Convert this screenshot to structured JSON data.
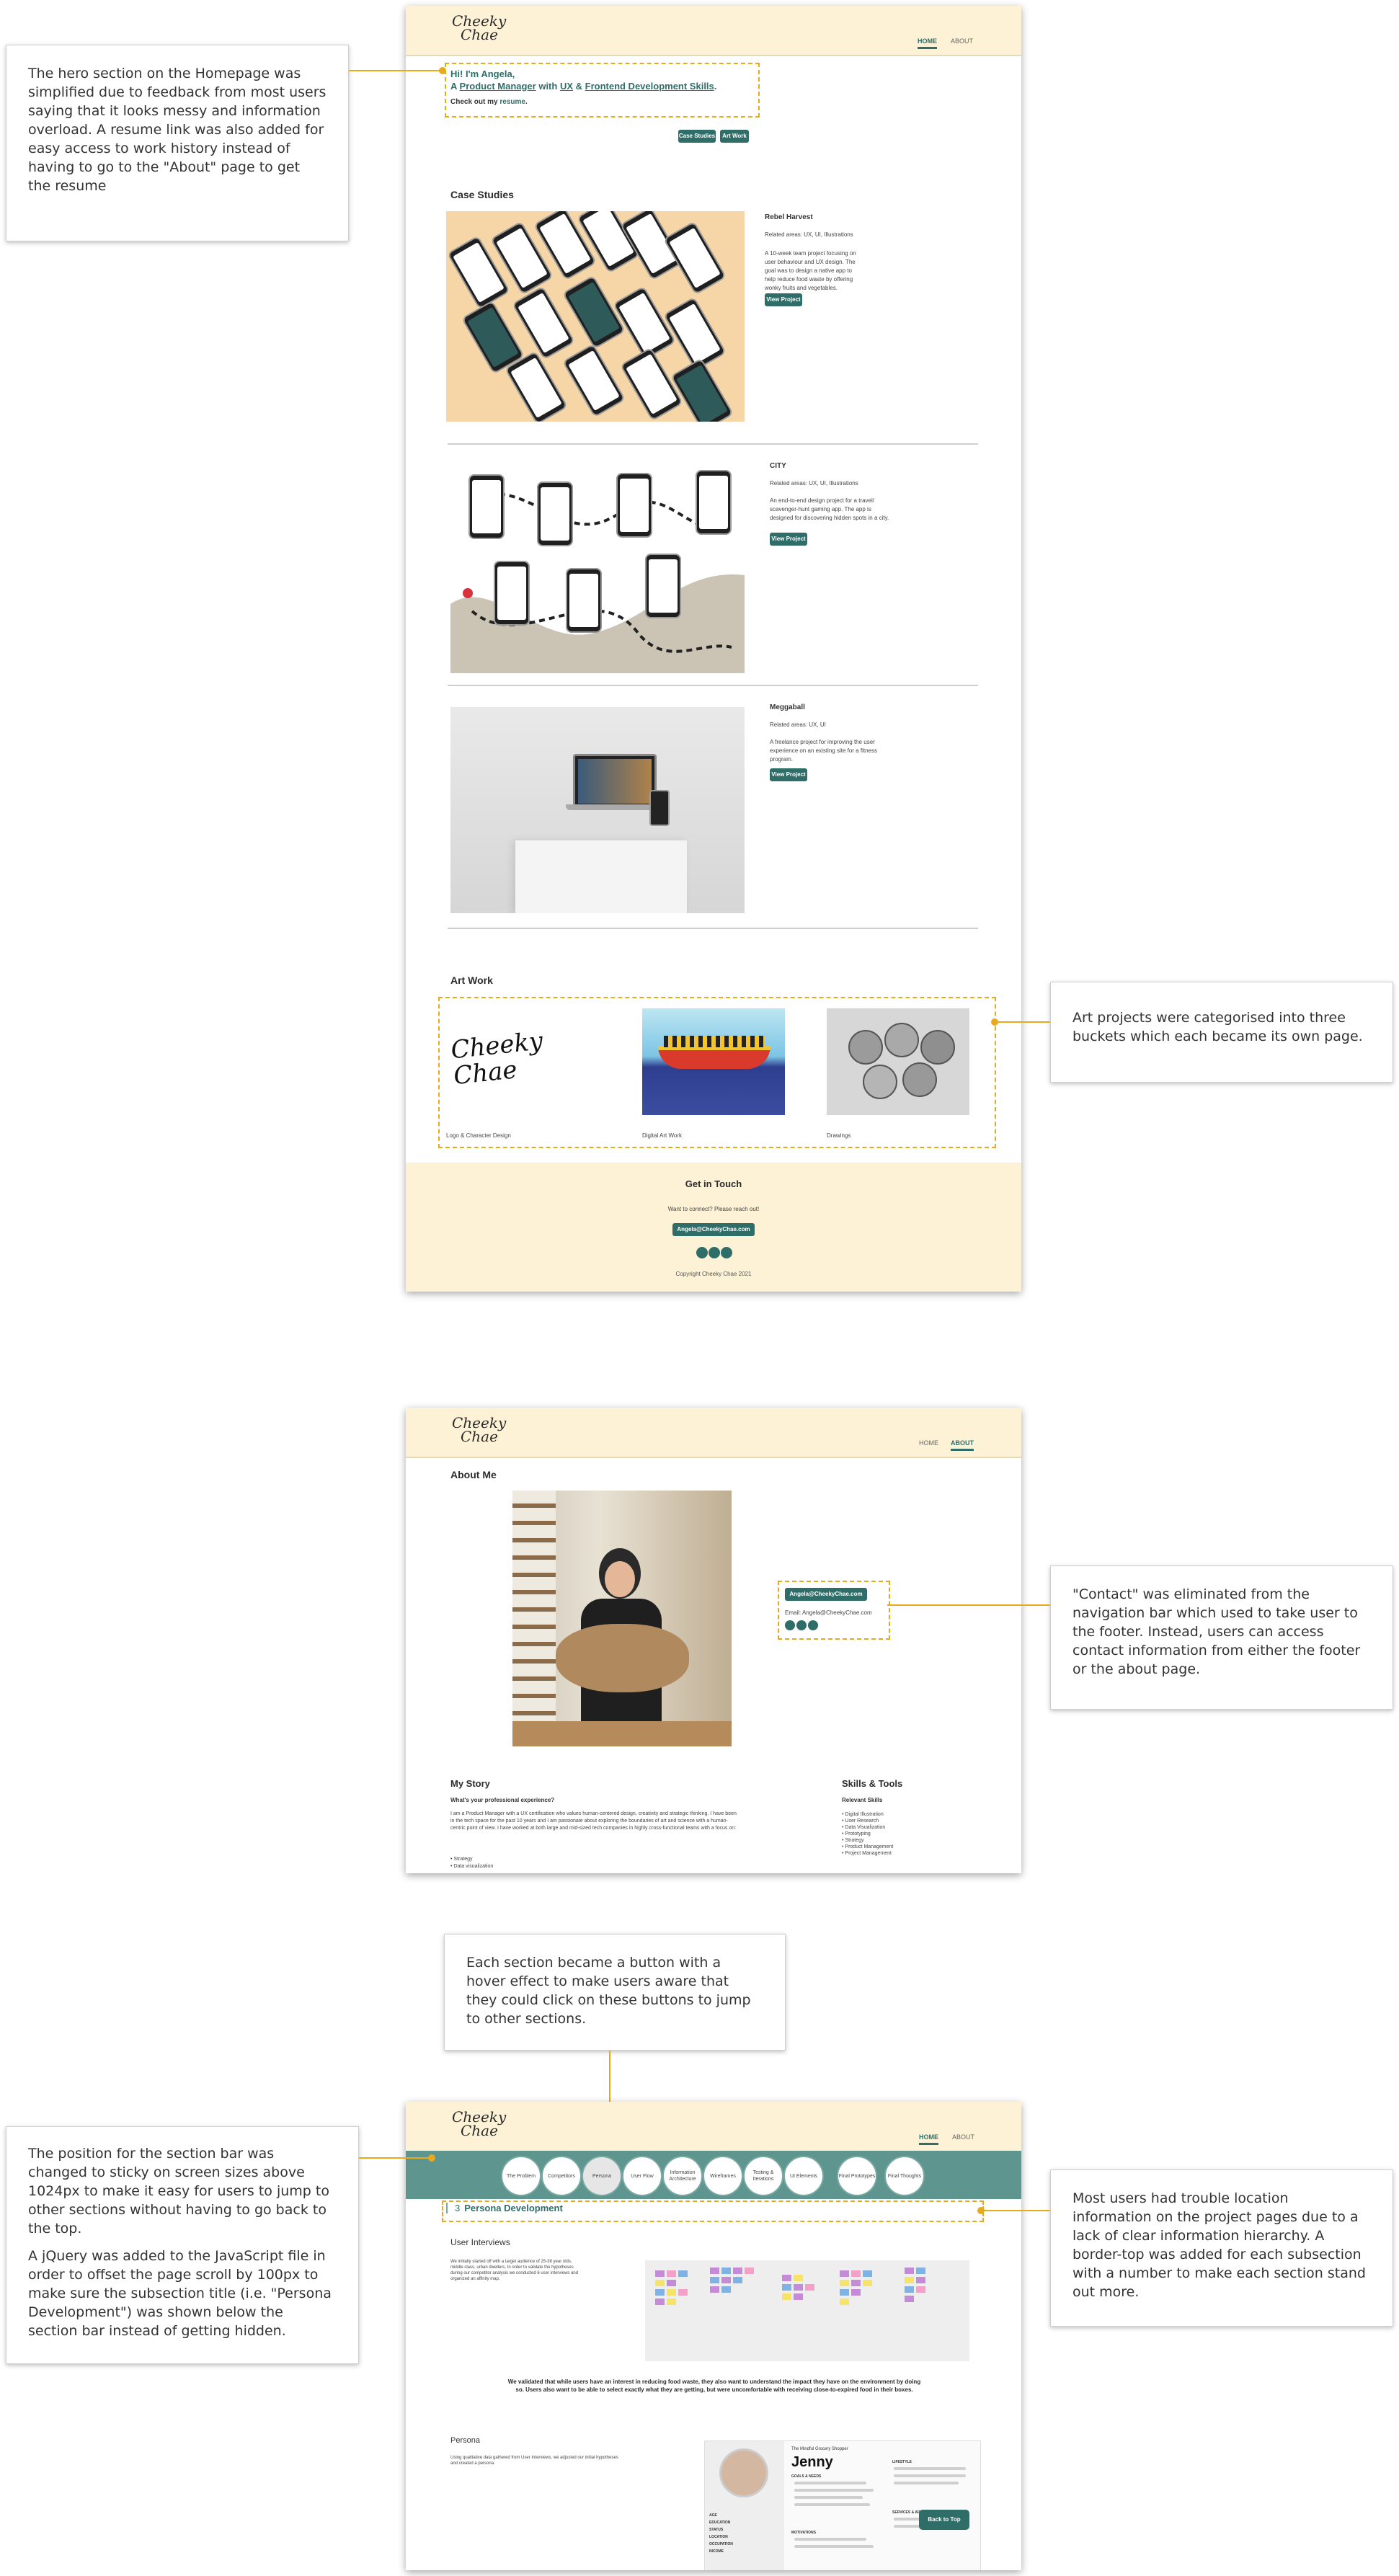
{
  "brand": {
    "logo_line1": "Cheeky",
    "logo_line2": "Chae"
  },
  "nav": {
    "home": "HOME",
    "about": "ABOUT"
  },
  "home": {
    "hero_line1": "Hi! I'm Angela,",
    "hero_a": "A ",
    "hero_pm": "Product Manager",
    "hero_with": " with ",
    "hero_ux": "UX",
    "hero_amp": " & ",
    "hero_fe": "Frontend Development Skills",
    "hero_dot": ".",
    "resume_prefix": "Check out my ",
    "resume_link": "resume",
    "resume_suffix": ".",
    "btn_case": "Case Studies",
    "btn_art": "Art Work",
    "case_title": "Case Studies",
    "cases": [
      {
        "title": "Rebel Harvest",
        "areas": "Related areas: UX, UI, Illustrations",
        "desc": "A 10-week team project focusing on user behaviour and UX design. The goal was to design a native app to help reduce food waste by offering wonky fruits and vegetables.",
        "btn": "View Project"
      },
      {
        "title": "CITY",
        "areas": "Related areas: UX, UI, Illustrations",
        "desc": "An end-to-end design project for a travel/ scavenger-hunt gaming app. The app is designed for discovering hidden spots in a city.",
        "btn": "View Project"
      },
      {
        "title": "Meggaball",
        "areas": "Related areas: UX, UI",
        "desc": "A freelance project for improving the user experience on an existing site for a fitness program.",
        "btn": "View Project"
      }
    ],
    "art_title": "Art Work",
    "art_items": [
      "Logo & Character Design",
      "Digital Art Work",
      "Drawings"
    ],
    "art_logo_text": "Cheeky Chae",
    "footer_title": "Get in Touch",
    "footer_sub": "Want to connect? Please reach out!",
    "footer_email": "Angela@CheekyChae.com",
    "footer_copy": "Copyright Cheeky Chae 2021"
  },
  "about": {
    "title": "About Me",
    "email_btn": "Angela@CheekyChae.com",
    "email_text": "Email: Angela@CheekyChae.com",
    "story_title": "My Story",
    "story_sub": "What's your professional experience?",
    "story_body": "I am a Product Manager with a UX certification who values human-centered design, creativity and strategic thinking. I have been in the tech space for the past 10 years and I am passionate about exploring the boundaries of art and science with a human-centric point of view. I have worked at both large and mid-sized tech companies in highly cross-functional teams with a focus on:",
    "story_list": [
      "Strategy",
      "Data visualization"
    ],
    "skills_title": "Skills & Tools",
    "skills_sub": "Relevant Skills",
    "skills": [
      "Digital Illustration",
      "User Research",
      "Data Visualization",
      "Prototyping",
      "Strategy",
      "Product Management",
      "Project Management"
    ]
  },
  "project": {
    "sections": [
      "The Problem",
      "Competitors",
      "Persona",
      "User Flow",
      "Information Architecture",
      "Wireframes",
      "Testing & Iterations",
      "UI Elements",
      "Final Prototypes",
      "Final Thoughts"
    ],
    "sub_num": "3",
    "sub_title": "Persona Development",
    "interviews_title": "User Interviews",
    "interviews_body": "We initially started off with a target audience of 25-38 year olds, middle class, urban dwellers. In order to validate the hypotheses during our competitor analysis we conducted 6 user interviews and organized an affinity map.",
    "quote": "We validated that while users have an interest in reducing food waste, they also want to understand the impact they have on the environment by doing so. Users also want to be able to select exactly what they are getting, but were uncomfortable with receiving close-to-expired food in their boxes.",
    "persona_title": "Persona",
    "persona_body": "Using qualitative data gathered from User Interviews, we adjusted our initial hypotheses and created a persona.",
    "persona_role": "The Mindful Grocery Shopper",
    "persona_name": "Jenny",
    "persona_goals": "GOALS & NEEDS",
    "persona_lifestyle": "LIFESTYLE",
    "persona_motivations": "MOTIVATIONS",
    "persona_services": "SERVICES & APPS",
    "persona_fields": [
      "AGE",
      "EDUCATION",
      "STATUS",
      "LOCATION",
      "OCCUPATION",
      "INCOME"
    ],
    "back_to_top": "Back to Top"
  },
  "callouts": {
    "hero": "The hero section on the Homepage was simplified due to feedback from most users saying that it looks messy and information overload. A resume link was also added for easy access to work history instead of having to go to the \"About\" page to get the resume",
    "art": "Art projects were categorised into three buckets which each became its own page.",
    "contact": "\"Contact\" was eliminated from the navigation bar which used to take user to the footer. Instead, users can access contact information from either the footer or the about page.",
    "section_buttons": "Each section became a button with a hover effect to make users aware that they could click on these buttons to jump to other sections.",
    "sticky_1": "The position for the section bar was changed to sticky on screen sizes above 1024px to make it easy for users to jump to other sections without having to go back to the top.",
    "sticky_2": "A jQuery was added to the JavaScript file in order to offset the page scroll by 100px to make sure the subsection title (i.e. \"Persona Development\") was shown below the section bar instead of getting hidden.",
    "hierarchy": "Most users had trouble location information on the project pages due to a lack of clear information hierarchy. A border-top was added for each subsection with a number to make each section stand out more."
  },
  "colors": {
    "accent": "#2f6e68",
    "header_bg": "#fdf2d6",
    "highlight": "#e9a91c",
    "section_bar": "#5e958f"
  }
}
